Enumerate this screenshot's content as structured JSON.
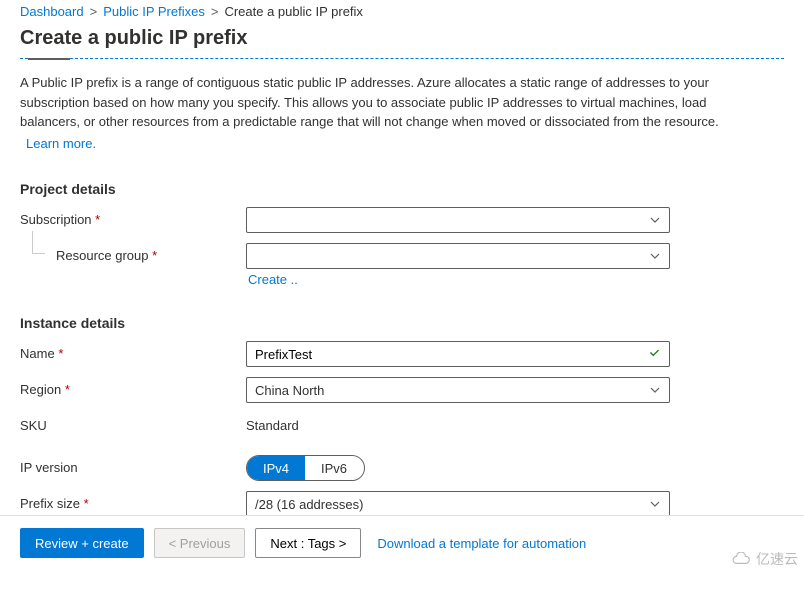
{
  "breadcrumb": {
    "items": [
      {
        "label": "Dashboard"
      },
      {
        "label": "Public IP Prefixes"
      }
    ],
    "current": "Create a public IP prefix"
  },
  "pageTitle": "Create a public IP prefix",
  "description": {
    "text": "A Public IP prefix is a range of contiguous static public IP addresses. Azure allocates a static range of addresses to your subscription based on how many you specify. This allows you to associate public IP addresses to virtual machines, load balancers, or other resources from a predictable range that will not change when moved or dissociated from the resource.",
    "learnMore": "Learn more."
  },
  "sections": {
    "project": {
      "title": "Project details",
      "subscriptionLabel": "Subscription",
      "subscriptionValue": "",
      "resourceGroupLabel": "Resource group",
      "resourceGroupValue": "",
      "createNew": "Create .."
    },
    "instance": {
      "title": "Instance details",
      "nameLabel": "Name",
      "nameValue": "PrefixTest",
      "regionLabel": "Region",
      "regionValue": "China North",
      "skuLabel": "SKU",
      "skuValue": "Standard",
      "ipVersionLabel": "IP version",
      "ipv4": "IPv4",
      "ipv6": "IPv6",
      "prefixSizeLabel": "Prefix size",
      "prefixSizeValue": "/28 (16 addresses)"
    }
  },
  "footer": {
    "reviewCreate": "Review + create",
    "previous": "< Previous",
    "next": "Next : Tags >",
    "download": "Download a template for automation"
  },
  "watermark": "亿速云"
}
